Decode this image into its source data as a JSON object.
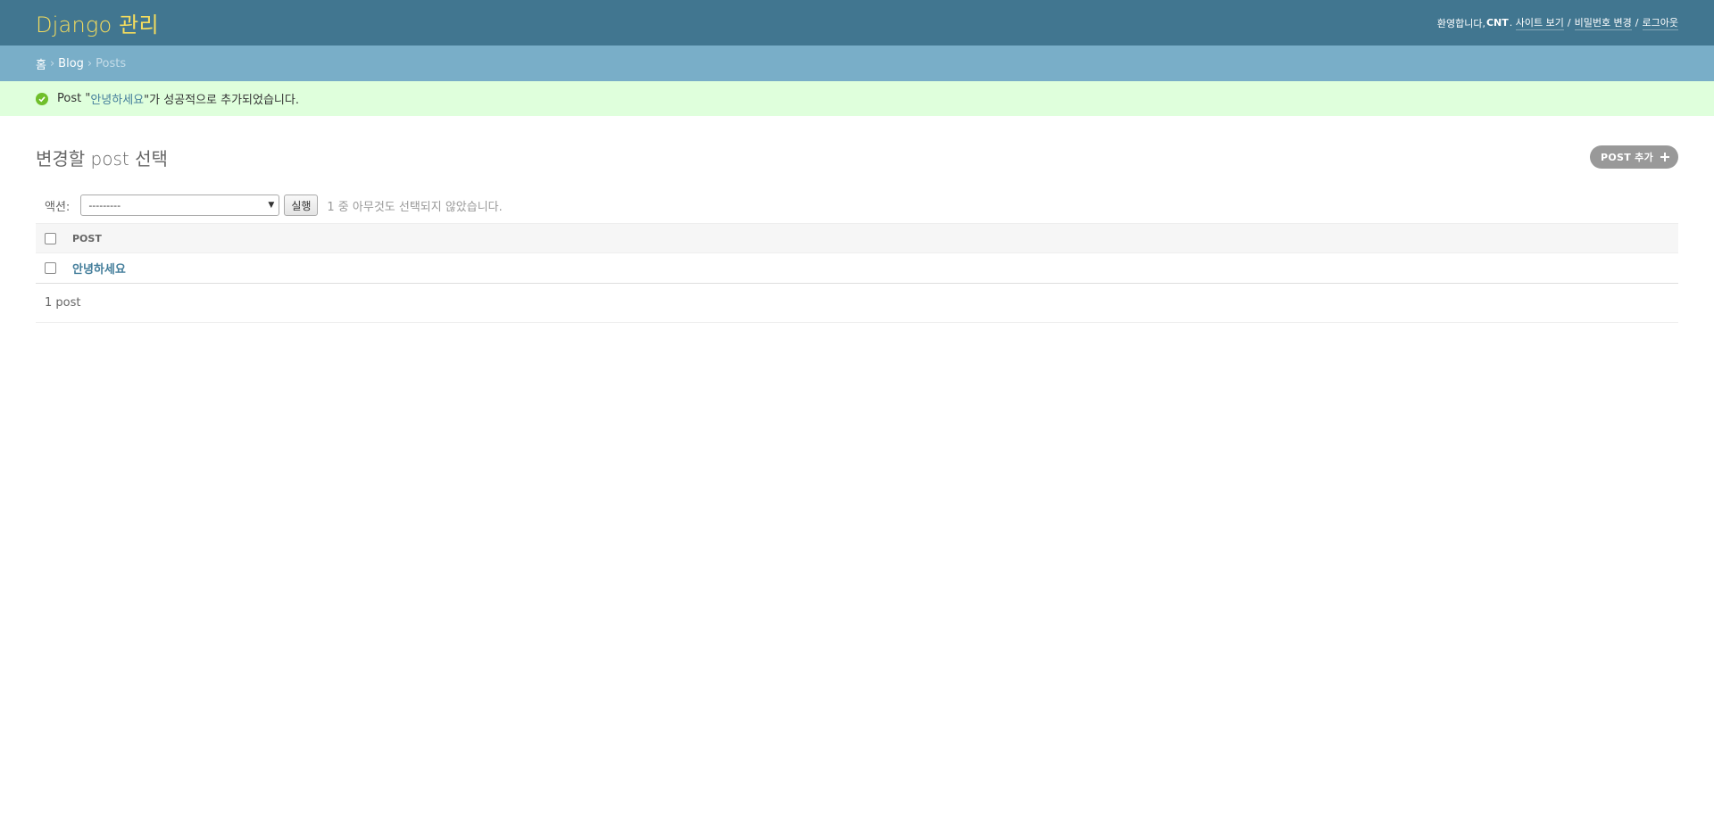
{
  "header": {
    "branding": "Django 관리",
    "welcome": "환영합니다,",
    "username": "CNT",
    "username_suffix": ".",
    "view_site": "사이트 보기",
    "change_password": "비밀번호 변경",
    "logout": "로그아웃",
    "separator": "/"
  },
  "breadcrumbs": {
    "home": "홈",
    "app": "Blog",
    "current": "Posts",
    "separator": "›"
  },
  "message": {
    "prefix": "Post \"",
    "link": "안녕하세요",
    "suffix": "\"가 성공적으로 추가되었습니다."
  },
  "content": {
    "title": "변경할 post 선택",
    "add_button": "POST 추가"
  },
  "actions": {
    "label": "액션:",
    "selected_option": "---------",
    "go_button": "실행",
    "counter": "1 중 아무것도 선택되지 않았습니다."
  },
  "table": {
    "column_header": "Post",
    "rows": [
      {
        "title": "안녕하세요"
      }
    ]
  },
  "paginator": {
    "text": "1 post"
  },
  "colors": {
    "header_bg": "#417690",
    "branding": "#f5dd5d",
    "breadcrumbs_bg": "#79aec8",
    "success_bg": "#dfffdc",
    "link": "#447e9b"
  }
}
